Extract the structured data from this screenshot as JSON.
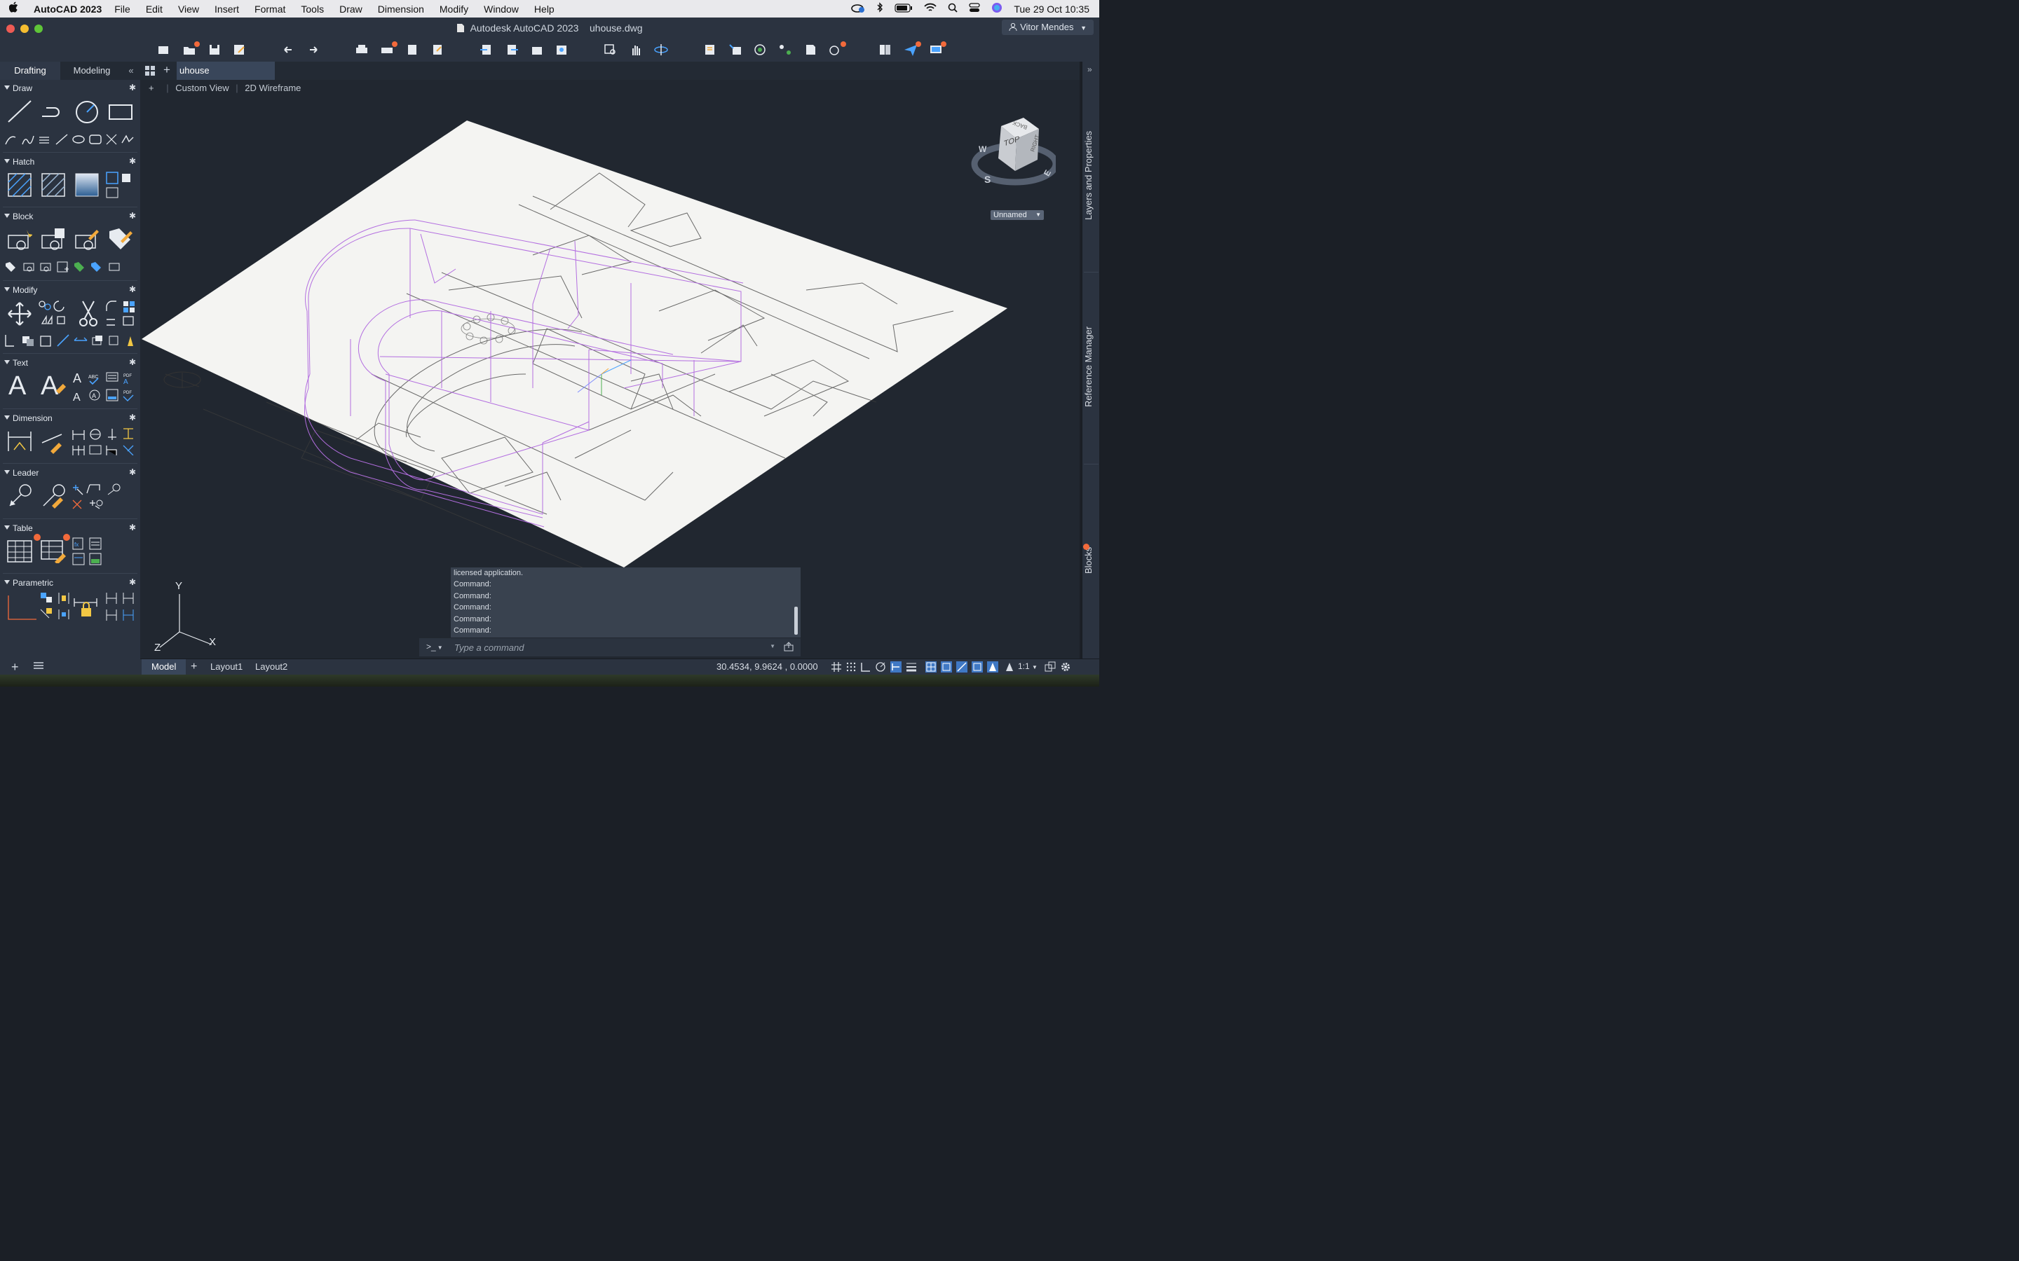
{
  "menubar": {
    "app_name": "AutoCAD 2023",
    "items": [
      "File",
      "Edit",
      "View",
      "Insert",
      "Format",
      "Tools",
      "Draw",
      "Dimension",
      "Modify",
      "Window",
      "Help"
    ],
    "clock": "Tue 29 Oct  10:35"
  },
  "titlebar": {
    "title": "Autodesk AutoCAD 2023    uhouse.dwg",
    "user": "Vitor Mendes"
  },
  "palette": {
    "tabs": [
      "Drafting",
      "Modeling"
    ],
    "sections": [
      "Draw",
      "Hatch",
      "Block",
      "Modify",
      "Text",
      "Dimension",
      "Leader",
      "Table",
      "Parametric"
    ]
  },
  "document": {
    "tab": "uhouse",
    "viewport_controls": [
      "+",
      "Custom View",
      "2D Wireframe"
    ],
    "viewcube": {
      "face_top": "TOP",
      "face_right": "RIGHT",
      "face_back": "BACK",
      "compass": [
        "W",
        "S",
        "E"
      ]
    },
    "ucs_dropdown": "Unnamed",
    "axes": [
      "Y",
      "X",
      "Z"
    ]
  },
  "right_panels": [
    "Layers and Properties",
    "Reference Manager",
    "Blocks"
  ],
  "command": {
    "history": [
      "licensed application.",
      "Command:",
      "Command:",
      "Command:",
      "Command:",
      "Command:"
    ],
    "prompt_icon": ">_",
    "placeholder": "Type a command"
  },
  "status": {
    "layout_tabs": [
      "Model",
      "Layout1",
      "Layout2"
    ],
    "coords": "30.4534, 9.9624 , 0.0000",
    "scale": "1:1"
  },
  "colors": {
    "accent_dot": "#f26a3b",
    "wireframe": "#b36ee0",
    "ui_bg": "#2b3340",
    "viewport_bg": "#212730"
  }
}
